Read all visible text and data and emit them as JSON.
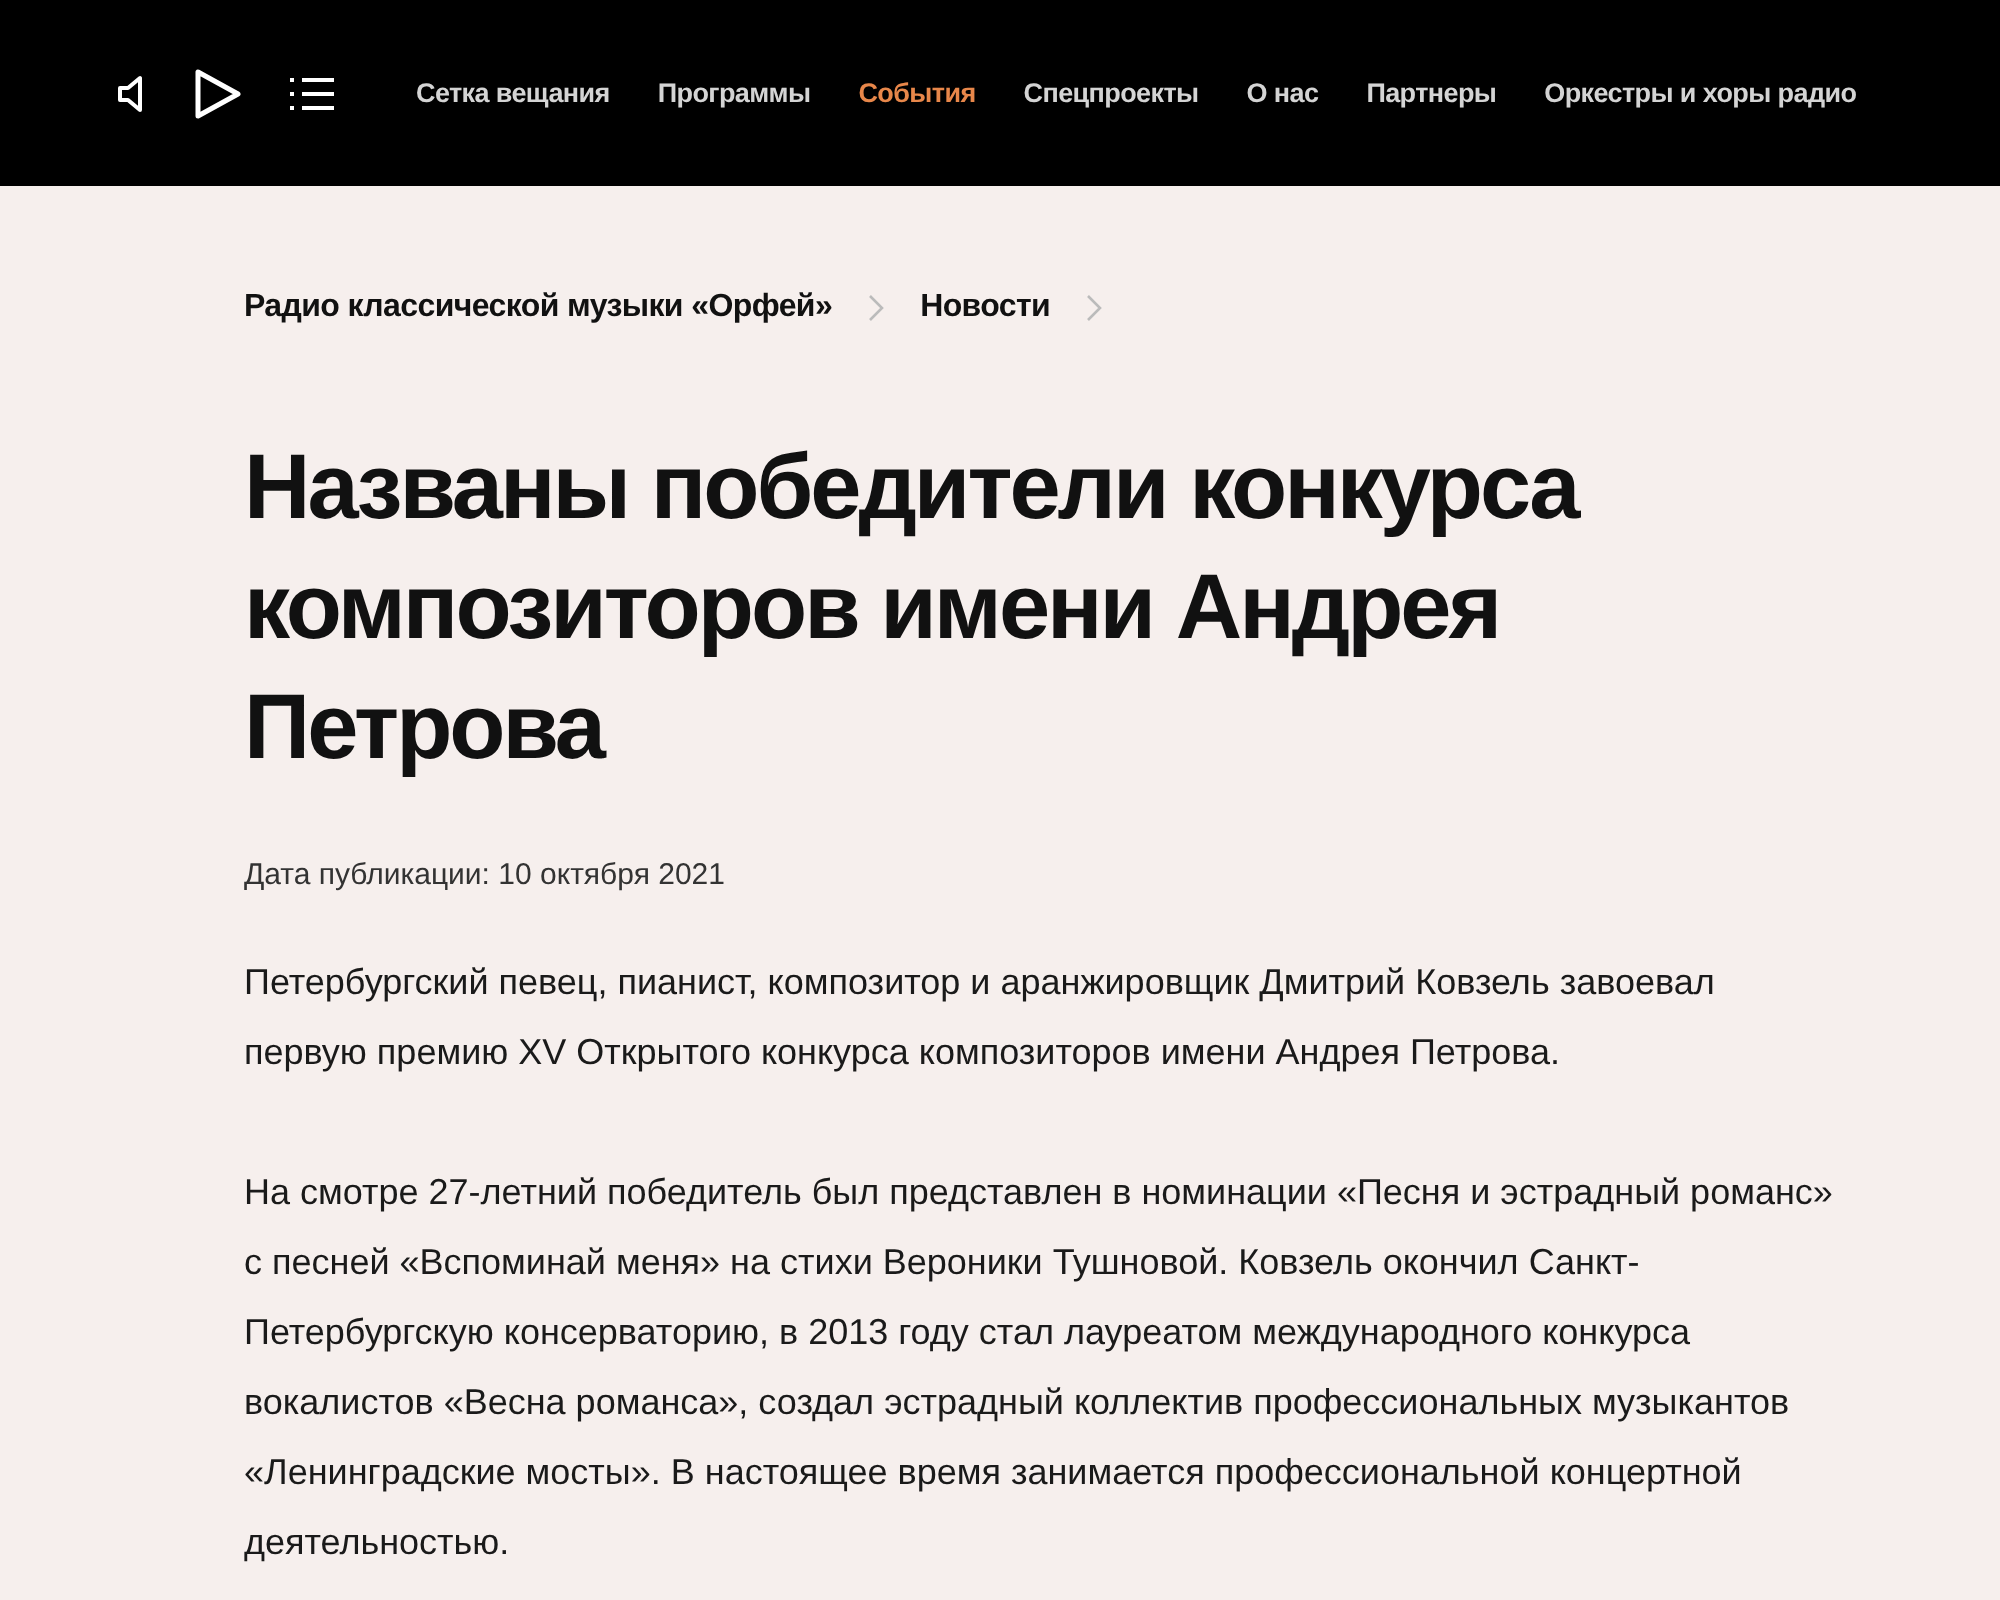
{
  "nav": [
    {
      "label": "Сетка вещания",
      "selected": false
    },
    {
      "label": "Программы",
      "selected": false
    },
    {
      "label": "События",
      "selected": true
    },
    {
      "label": "Спецпроекты",
      "selected": false
    },
    {
      "label": "О нас",
      "selected": false
    },
    {
      "label": "Партнеры",
      "selected": false
    },
    {
      "label": "Оркестры и хоры радио",
      "selected": false
    }
  ],
  "breadcrumbs": [
    "Радио классической музыки «Орфей»",
    "Новости"
  ],
  "title": "Названы победители конкурса композиторов имени Андрея Петрова",
  "date": "Дата публикации: 10 октября 2021",
  "paragraphs": [
    "Петербургский певец, пианист, композитор и аранжировщик Дмитрий Ковзель завоевал первую премию XV Открытого конкурса композиторов имени Андрея Петрова.",
    "На смотре 27-летний победитель был представлен в номинации «Песня и эстрадный романс» с песней «Вспоминай меня» на стихи Вероники Тушновой. Ковзель окончил Санкт-Петербургскую консерваторию, в 2013 году стал лауреатом международного конкурса вокалистов «Весна романса», создал эстрадный коллектив профессиональных музыкантов «Ленинградские мосты». В настоящее время занимается профессиональной концертной деятельностью."
  ]
}
